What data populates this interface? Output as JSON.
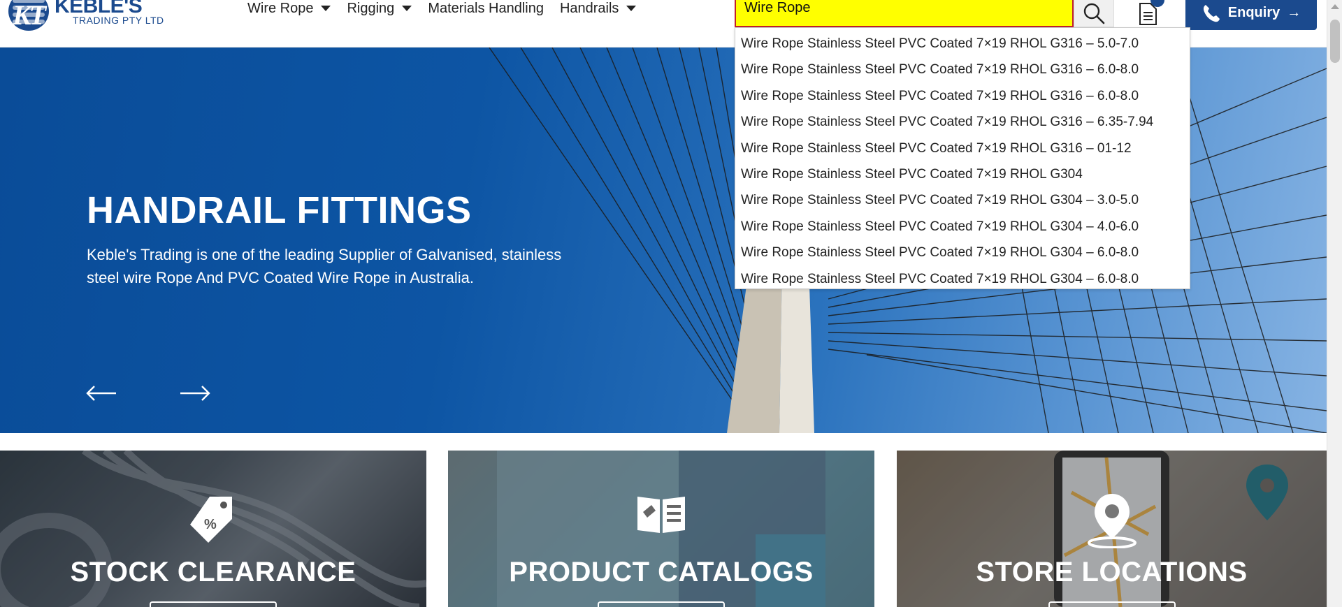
{
  "logo": {
    "mark": "KT",
    "name": "KEBLE'S",
    "sub": "TRADING PTY LTD"
  },
  "nav": [
    {
      "label": "Wire Rope",
      "has_dropdown": true
    },
    {
      "label": "Rigging",
      "has_dropdown": true
    },
    {
      "label": "Materials Handling",
      "has_dropdown": false
    },
    {
      "label": "Handrails",
      "has_dropdown": true
    }
  ],
  "search": {
    "value": "Wire Rope",
    "highlight_color": "#ffff00",
    "border_color": "#c0202a"
  },
  "header_icons": {
    "search": "search-icon",
    "quote": "document-icon",
    "phone": "phone-icon"
  },
  "enquiry": {
    "label": "Enquiry",
    "arrow": "→",
    "bg": "#1b4a8e"
  },
  "suggestions": [
    "Wire Rope Stainless Steel PVC Coated 7×19 RHOL G316 – 5.0-7.0",
    "Wire Rope Stainless Steel PVC Coated 7×19 RHOL G316 – 6.0-8.0",
    "Wire Rope Stainless Steel PVC Coated 7×19 RHOL G316 – 6.0-8.0",
    "Wire Rope Stainless Steel PVC Coated 7×19 RHOL G316 – 6.35-7.94",
    "Wire Rope Stainless Steel PVC Coated 7×19 RHOL G316 – 01-12",
    "Wire Rope Stainless Steel PVC Coated 7×19 RHOL G304",
    "Wire Rope Stainless Steel PVC Coated 7×19 RHOL G304 – 3.0-5.0",
    "Wire Rope Stainless Steel PVC Coated 7×19 RHOL G304 – 4.0-6.0",
    "Wire Rope Stainless Steel PVC Coated 7×19 RHOL G304 – 6.0-8.0",
    "Wire Rope Stainless Steel PVC Coated 7×19 RHOL G304 – 6.0-8.0"
  ],
  "hero": {
    "title": "HANDRAIL FITTINGS",
    "description": "Keble's Trading is one of the leading Supplier of Galvanised, stainless steel wire Rope And PVC Coated Wire Rope in Australia."
  },
  "cards": [
    {
      "title": "STOCK CLEARANCE",
      "icon": "price-tag-icon"
    },
    {
      "title": "PRODUCT CATALOGS",
      "icon": "open-book-icon"
    },
    {
      "title": "STORE LOCATIONS",
      "icon": "map-pin-icon"
    }
  ],
  "colors": {
    "brand": "#1b4a8e"
  }
}
